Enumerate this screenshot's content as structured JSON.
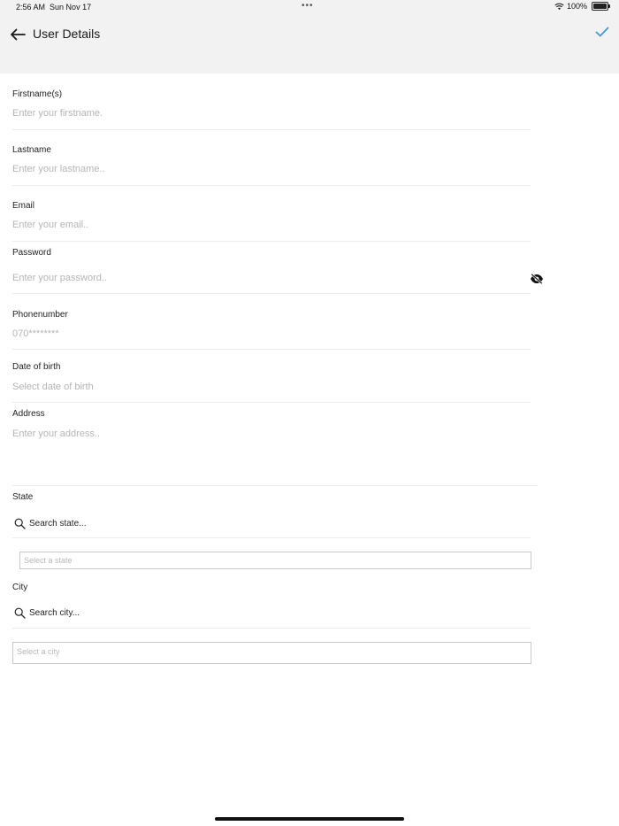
{
  "status_bar": {
    "time": "2:56 AM",
    "date": "Sun Nov 17",
    "dots": "•••",
    "battery": "100%"
  },
  "header": {
    "title": "User Details",
    "back_icon": "arrow-left-icon",
    "confirm_icon": "checkmark-icon",
    "accent_color": "#3b9ad9"
  },
  "form": {
    "firstname": {
      "label": "Firstname(s)",
      "placeholder": "Enter your firstname."
    },
    "lastname": {
      "label": "Lastname",
      "placeholder": "Enter your lastname.."
    },
    "email": {
      "label": "Email",
      "placeholder": "Enter your email.."
    },
    "password": {
      "label": "Password",
      "placeholder": "Enter your password..",
      "toggle_icon": "eye-off-icon"
    },
    "phone": {
      "label": "Phonenumber",
      "placeholder": "070********"
    },
    "dob": {
      "label": "Date of birth",
      "placeholder": "Select date of birth"
    },
    "address": {
      "label": "Address",
      "placeholder": "Enter your address.."
    },
    "state": {
      "label": "State",
      "search_placeholder": "Search state...",
      "select_placeholder": "Select a state"
    },
    "city": {
      "label": "City",
      "search_placeholder": "Search city...",
      "select_placeholder": "Select a city"
    }
  }
}
